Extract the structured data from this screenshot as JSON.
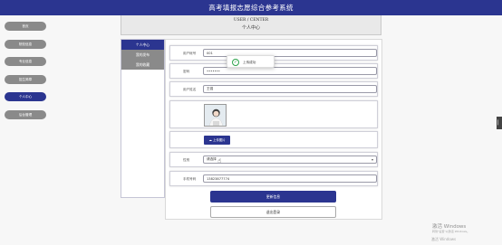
{
  "app": {
    "title": "高考填报志愿综合参考系统"
  },
  "nav": {
    "items": [
      {
        "label": "首页",
        "active": false
      },
      {
        "label": "院校信息",
        "active": false
      },
      {
        "label": "专业信息",
        "active": false
      },
      {
        "label": "招生简章",
        "active": false
      },
      {
        "label": "个人中心",
        "active": true
      },
      {
        "label": "后台管理",
        "active": false
      }
    ]
  },
  "panel": {
    "title_en": "USER / CENTER",
    "title_zh": "个人中心"
  },
  "tabs": [
    {
      "label": "个人中心",
      "active": true
    },
    {
      "label": "我的发布",
      "active": false
    },
    {
      "label": "我的收藏",
      "active": false
    }
  ],
  "form": {
    "account_label": "用户帐号",
    "account_value": "001",
    "password_label": "密码",
    "password_value": "•••••••",
    "name_label": "用户姓名",
    "name_value": "王强",
    "upload_label": "上传图片",
    "gender_label": "性别",
    "gender_value": "请选择",
    "phone_label": "手机号码",
    "phone_value": "13823877774",
    "submit_label": "更新信息",
    "logout_label": "退出登录"
  },
  "toast": {
    "message": "上传成功"
  },
  "watermark": {
    "line1": "激活 Windows",
    "line2": "转到\"设置\"以激活 Windows。",
    "line3": "激活 Windows"
  },
  "icons": {
    "success": "check-circle-icon",
    "upload": "cloud-upload-icon",
    "dropdown": "chevron-down-icon"
  },
  "colors": {
    "primary": "#2b3590",
    "nav_inactive": "#8a8a8a",
    "success": "#2ca34b"
  }
}
